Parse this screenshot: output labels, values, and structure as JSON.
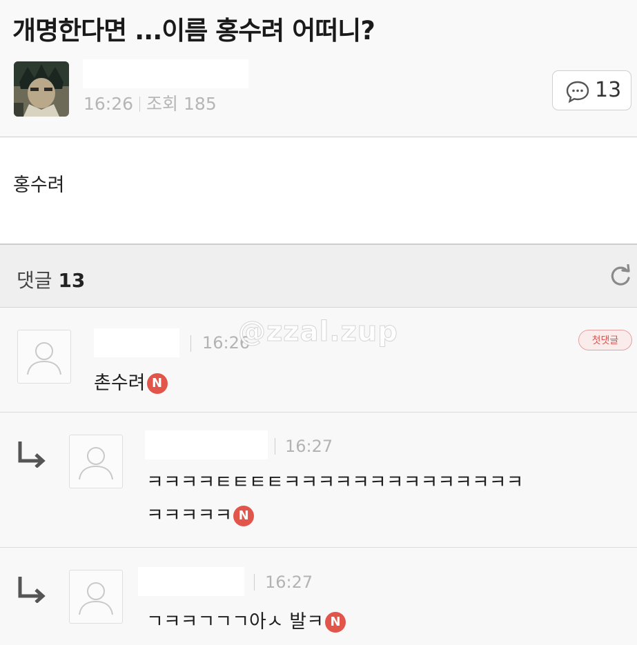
{
  "post": {
    "title": "개명한다면 ...이름 홍수려 어떠니?",
    "time": "16:26",
    "views_label": "조회",
    "views": "185",
    "comment_count": "13",
    "body": "홍수려"
  },
  "comments_section": {
    "label": "댓글",
    "count": "13"
  },
  "comments": [
    {
      "time": "16:26",
      "text": "촌수려",
      "badge": "N",
      "first_badge": "첫댓글"
    },
    {
      "time": "16:27",
      "text_line1": "ㅋㅋㅋㅋㅌㅌㅌㅌㅋㅋㅋㅋㅋㅋㅋㅋㅋㅋㅋㅋㅋㅋ",
      "text_line2": "ㅋㅋㅋㅋㅋ",
      "badge": "N"
    },
    {
      "time": "16:27",
      "text": "ㄱㅋㅋㄱㄱㄱ아ㅅ 발ㅋ",
      "badge": "N"
    }
  ],
  "watermark": "@zzal.zup",
  "colors": {
    "badge_red": "#e2554a",
    "meta_gray": "#b6b6b6",
    "divider": "#cfcfcf"
  }
}
